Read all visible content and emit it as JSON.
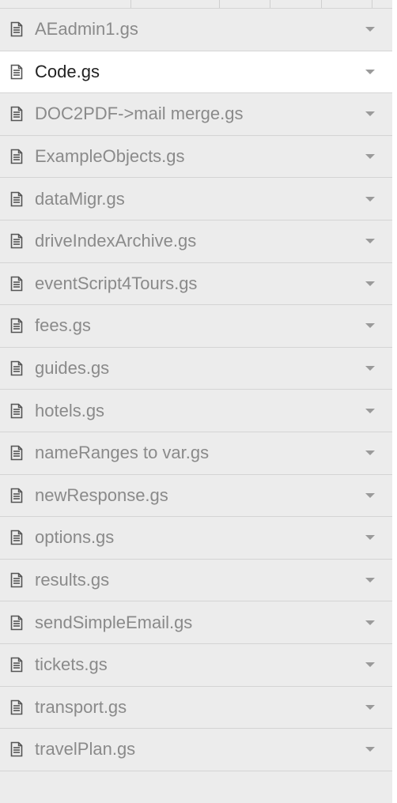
{
  "files": [
    {
      "name": "AEadmin1.gs",
      "active": false
    },
    {
      "name": "Code.gs",
      "active": true
    },
    {
      "name": "DOC2PDF->mail merge.gs",
      "active": false
    },
    {
      "name": "ExampleObjects.gs",
      "active": false
    },
    {
      "name": "dataMigr.gs",
      "active": false
    },
    {
      "name": "driveIndexArchive.gs",
      "active": false
    },
    {
      "name": "eventScript4Tours.gs",
      "active": false
    },
    {
      "name": "fees.gs",
      "active": false
    },
    {
      "name": "guides.gs",
      "active": false
    },
    {
      "name": "hotels.gs",
      "active": false
    },
    {
      "name": "nameRanges to var.gs",
      "active": false
    },
    {
      "name": "newResponse.gs",
      "active": false
    },
    {
      "name": "options.gs",
      "active": false
    },
    {
      "name": "results.gs",
      "active": false
    },
    {
      "name": "sendSimpleEmail.gs",
      "active": false
    },
    {
      "name": "tickets.gs",
      "active": false
    },
    {
      "name": "transport.gs",
      "active": false
    },
    {
      "name": "travelPlan.gs",
      "active": false
    }
  ],
  "icons": {
    "file": "document-icon",
    "menu": "chevron-down-icon"
  },
  "colors": {
    "panel_bg": "#ececec",
    "active_bg": "#ffffff",
    "text_inactive": "#8a8a8a",
    "text_active": "#222222"
  }
}
